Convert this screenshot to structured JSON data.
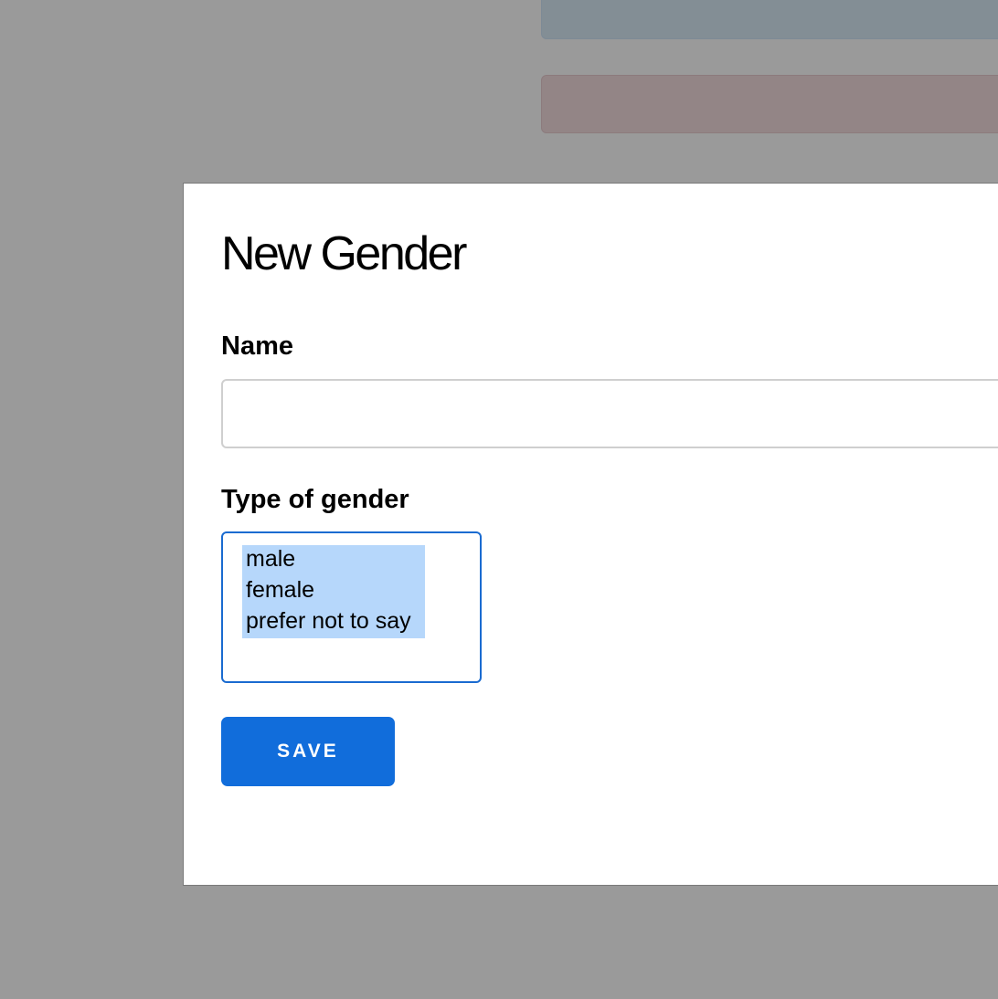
{
  "modal": {
    "title": "New Gender",
    "name_field": {
      "label": "Name",
      "value": "",
      "placeholder": ""
    },
    "gender_field": {
      "label": "Type of gender",
      "options": [
        "male",
        "female",
        "prefer not to say"
      ],
      "selected": [
        "male",
        "female",
        "prefer not to say"
      ]
    },
    "save_label": "SAVE"
  },
  "colors": {
    "overlay": "#9a9a9a",
    "accent": "#116ddb",
    "selection": "#b6d7fb",
    "background_bar_blue": "#838e95",
    "background_bar_red": "#938586"
  }
}
